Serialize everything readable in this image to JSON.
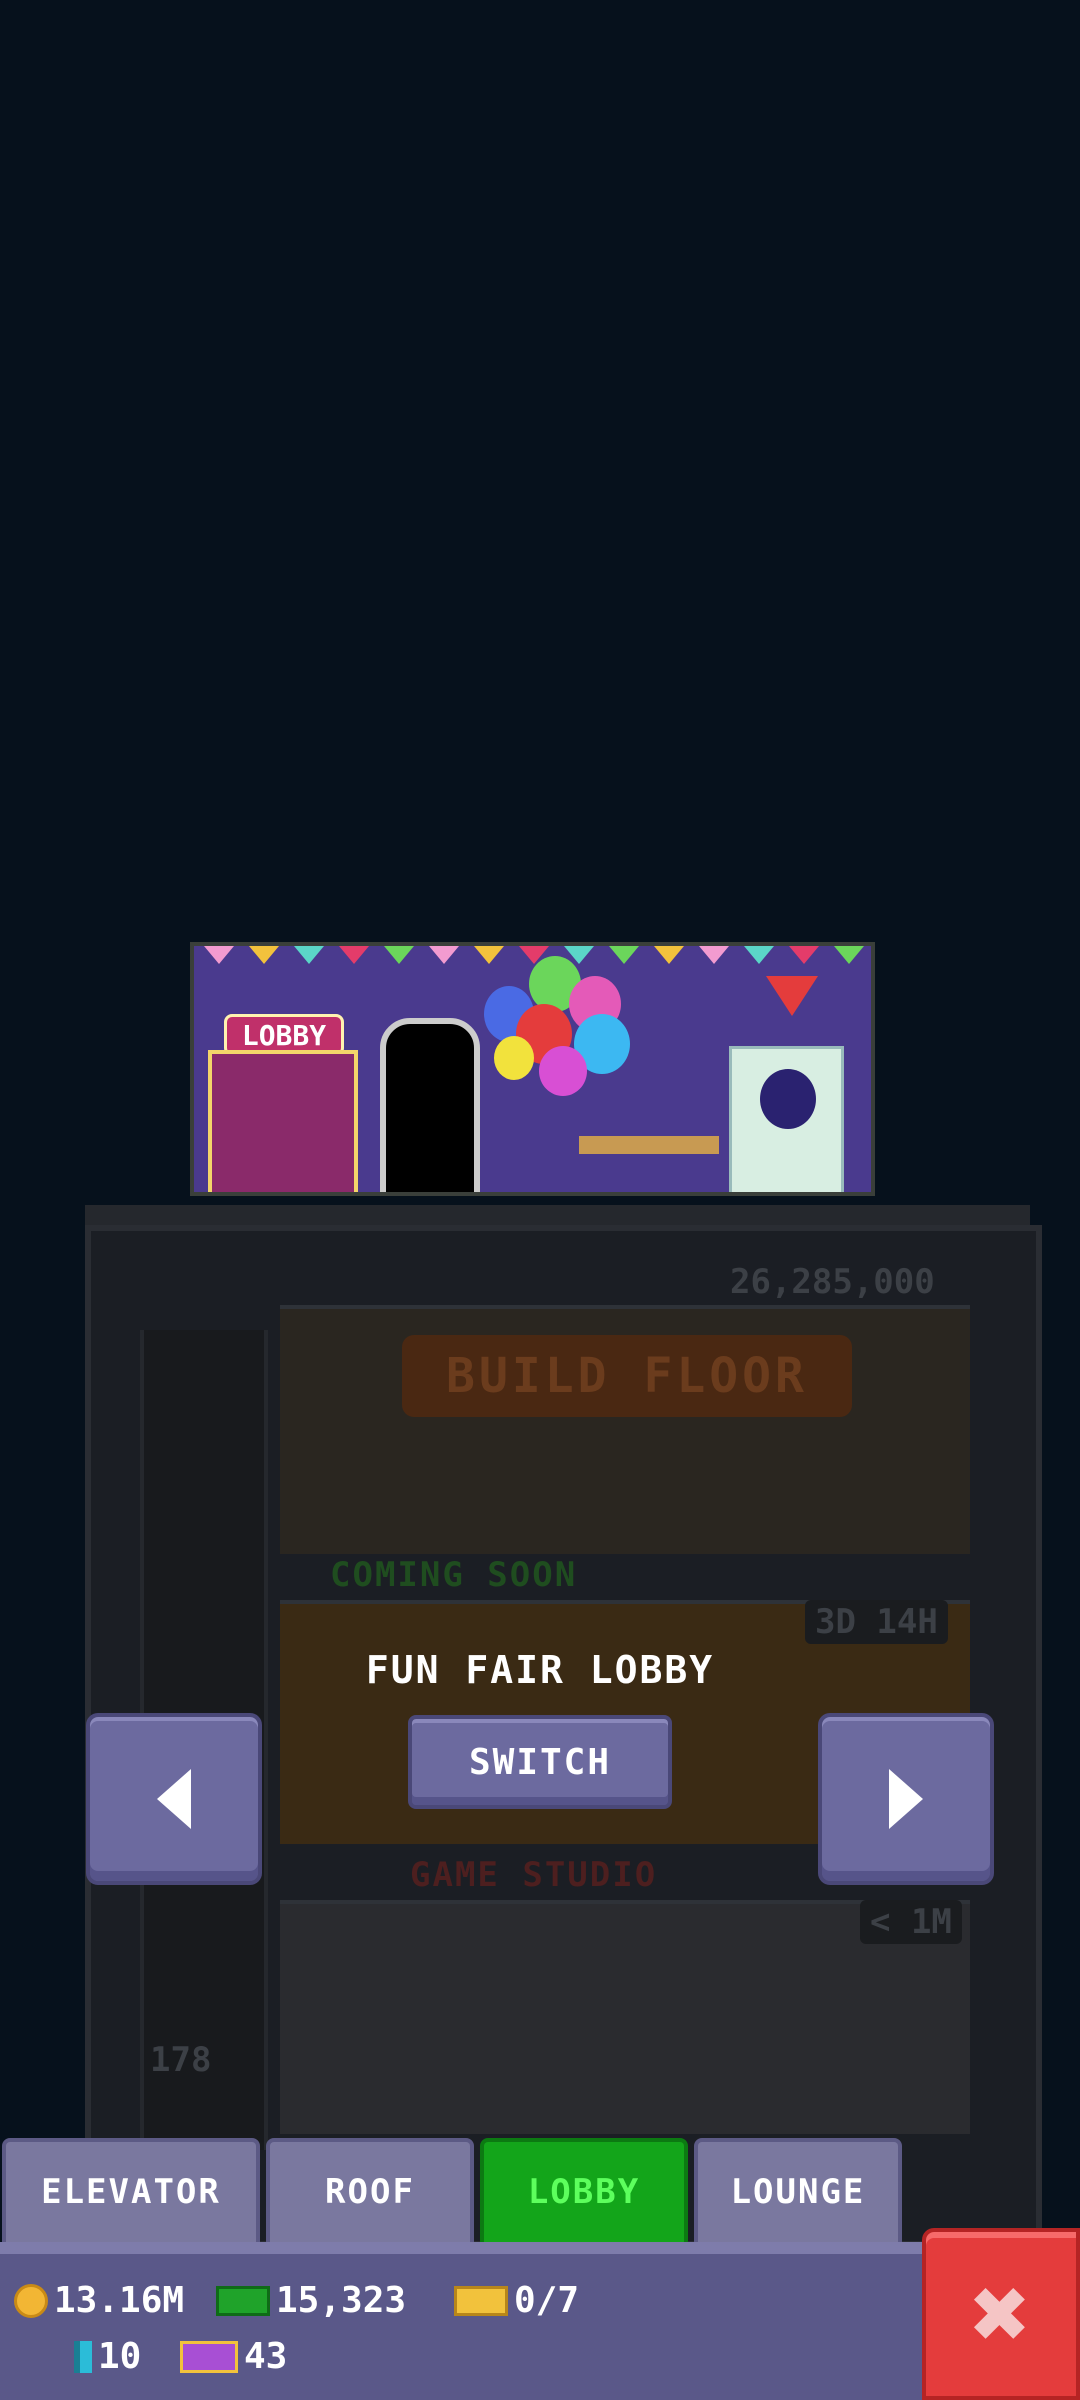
{
  "background": {
    "build_floor_label": "BUILD FLOOR",
    "build_floor_cost": "26,285,000",
    "coming_soon": "COMING SOON",
    "timer": "3D 14H",
    "game_studio_label": "GAME STUDIO",
    "game_studio_income": "< 1M",
    "elevator_floor": "178"
  },
  "preview": {
    "lobby_sign": "LOBBY",
    "caption": "FUN FAIR LOBBY",
    "switch_label": "SWITCH"
  },
  "tabs": [
    {
      "label": "ELEVATOR",
      "active": false
    },
    {
      "label": "ROOF",
      "active": false
    },
    {
      "label": "LOBBY",
      "active": true
    },
    {
      "label": "LOUNGE",
      "active": false
    }
  ],
  "stats": {
    "coins": "13.16M",
    "bux": "15,323",
    "tickets": "0/7",
    "bitbooks": "10",
    "vip": "43"
  },
  "colors": {
    "accent": "#6c6a9f",
    "active_tab": "#13a51a",
    "close": "#e43c3c"
  }
}
